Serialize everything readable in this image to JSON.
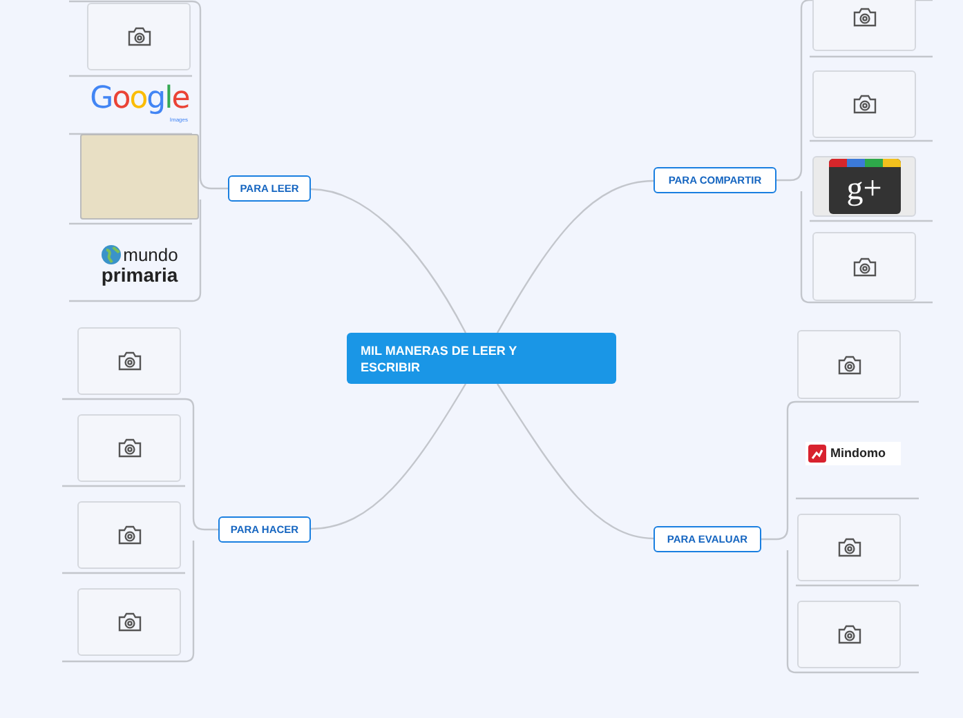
{
  "central_topic": "MIL MANERAS DE LEER Y ESCRIBIR",
  "branches": [
    {
      "label": "PARA LEER",
      "children": [
        {
          "kind": "camera"
        },
        {
          "kind": "wordmark",
          "texts": [
            "Google",
            "Images"
          ]
        },
        {
          "kind": "worksheet"
        },
        {
          "kind": "mundo",
          "texts": [
            "mundo",
            "primaria"
          ]
        }
      ]
    },
    {
      "label": "PARA COMPARTIR",
      "children": [
        {
          "kind": "camera"
        },
        {
          "kind": "camera"
        },
        {
          "kind": "gplus",
          "texts": [
            "g+"
          ]
        },
        {
          "kind": "camera"
        }
      ]
    },
    {
      "label": "PARA HACER",
      "children": [
        {
          "kind": "camera"
        },
        {
          "kind": "camera"
        },
        {
          "kind": "camera"
        },
        {
          "kind": "camera"
        }
      ]
    },
    {
      "label": "PARA EVALUAR",
      "children": [
        {
          "kind": "camera"
        },
        {
          "kind": "mindomo",
          "texts": [
            "Mindomo"
          ]
        },
        {
          "kind": "camera"
        },
        {
          "kind": "camera"
        }
      ]
    }
  ]
}
